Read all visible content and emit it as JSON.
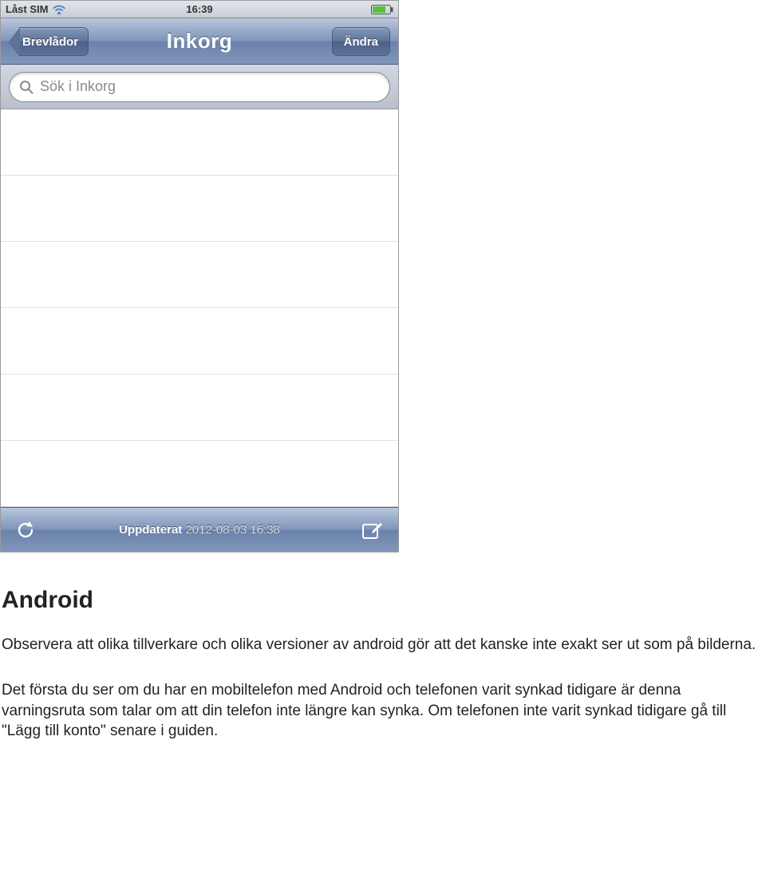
{
  "statusBar": {
    "carrier": "Låst SIM",
    "time": "16:39"
  },
  "navBar": {
    "backLabel": "Brevlådor",
    "title": "Inkorg",
    "editLabel": "Ändra"
  },
  "search": {
    "placeholder": "Sök i Inkorg"
  },
  "bottomBar": {
    "statusLabel": "Uppdaterat",
    "timestamp": "2012-08-03 16:38"
  },
  "doc": {
    "heading": "Android",
    "p1": "Observera att olika tillverkare och olika versioner av android gör att det kanske inte exakt ser ut som på bilderna.",
    "p2": "Det första du ser om du har en mobiltelefon med Android och telefonen varit synkad tidigare är denna varningsruta som talar om att din telefon inte längre kan synka. Om telefonen inte varit synkad tidigare gå till \"Lägg till konto\" senare i guiden."
  }
}
